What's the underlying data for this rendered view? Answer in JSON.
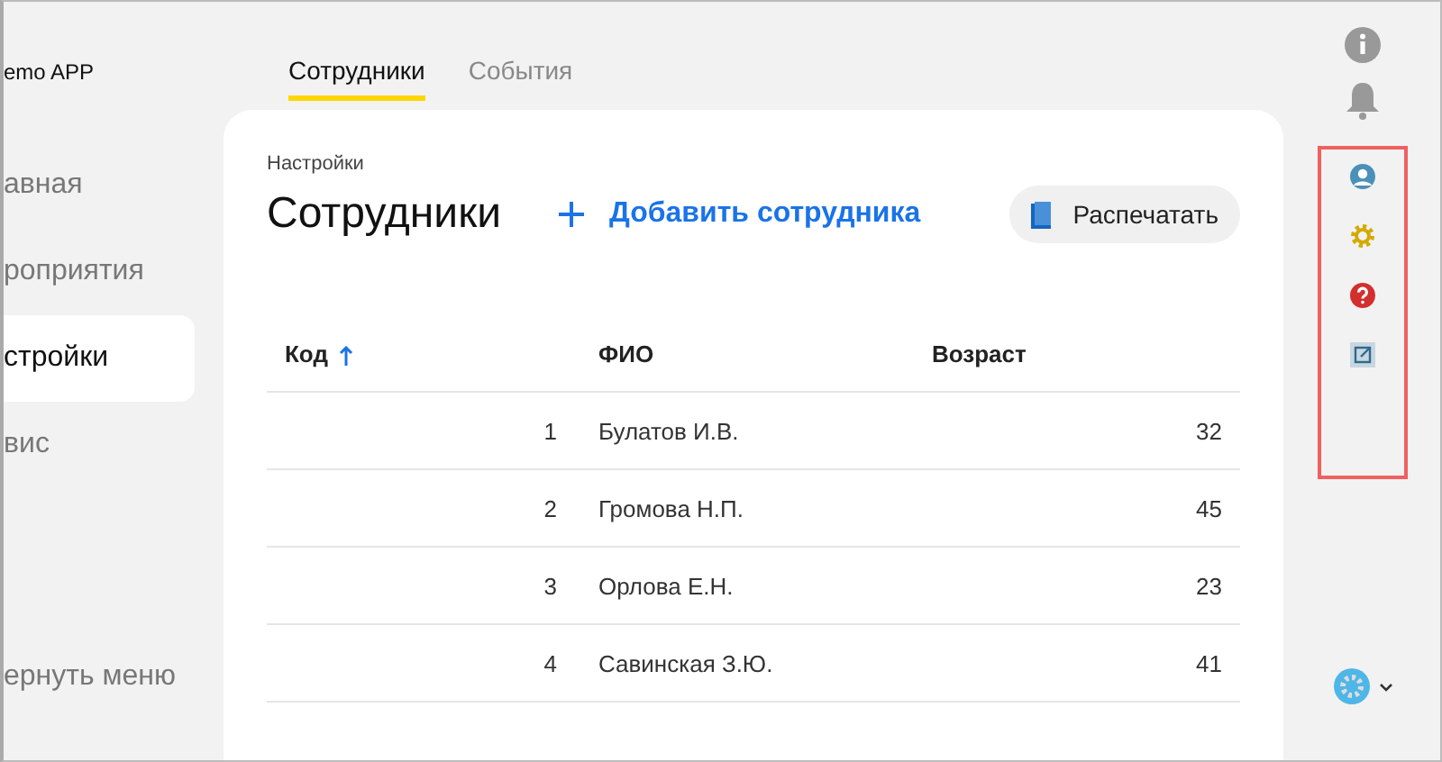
{
  "app_title": "emo APP",
  "sidebar": {
    "items": [
      {
        "label": "авная",
        "selected": false
      },
      {
        "label": "роприятия",
        "selected": false
      },
      {
        "label": "стройки",
        "selected": true
      },
      {
        "label": "вис",
        "selected": false
      }
    ],
    "collapse": "ернуть меню"
  },
  "tabs": [
    {
      "label": "Сотрудники",
      "selected": true
    },
    {
      "label": "События",
      "selected": false
    }
  ],
  "breadcrumb": "Настройки",
  "page_title": "Сотрудники",
  "add_button": "Добавить сотрудника",
  "print_button": "Распечатать",
  "table": {
    "columns": [
      {
        "label": "Код",
        "sorted": true
      },
      {
        "label": "ФИО",
        "sorted": false
      },
      {
        "label": "Возраст",
        "sorted": false
      }
    ],
    "rows": [
      [
        "1",
        "Булатов И.В.",
        "32"
      ],
      [
        "2",
        "Громова Н.П.",
        "45"
      ],
      [
        "3",
        "Орлова Е.Н.",
        "23"
      ],
      [
        "4",
        "Савинская З.Ю.",
        "41"
      ]
    ]
  }
}
